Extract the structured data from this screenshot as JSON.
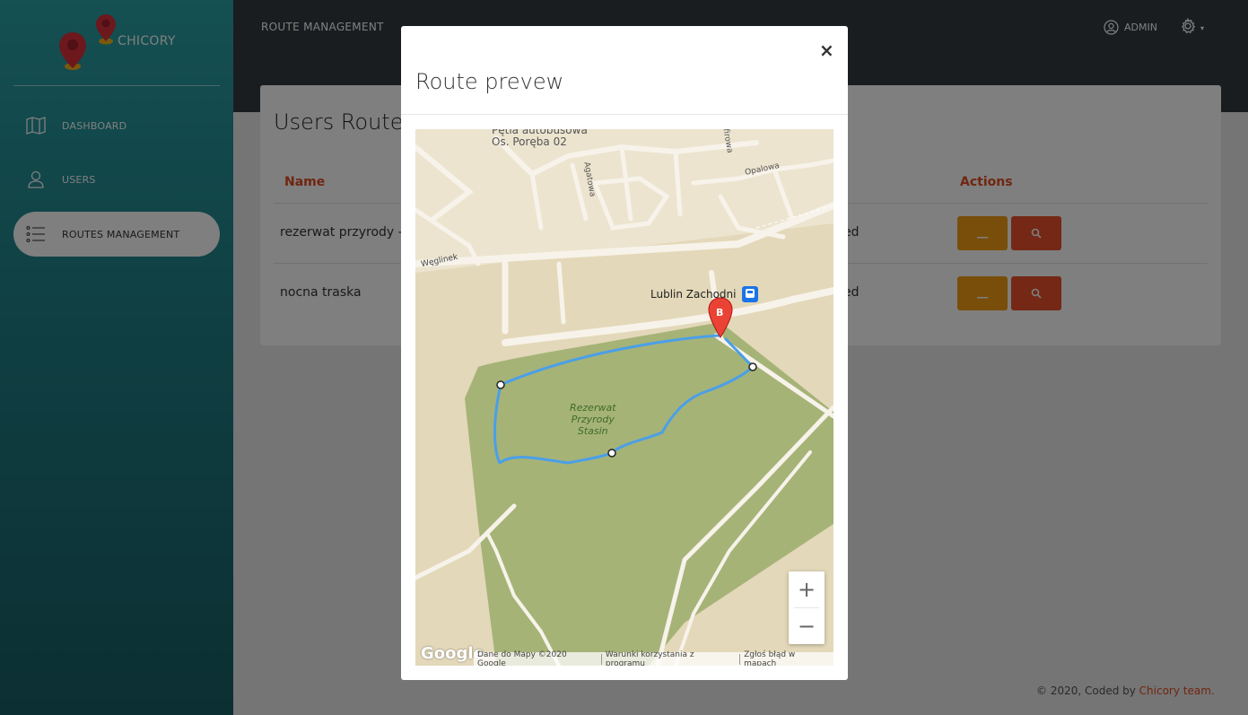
{
  "brand": {
    "name": "CHICORY",
    "pin_colors": [
      "#e0303a",
      "#f3b21b"
    ]
  },
  "topbar": {
    "title": "ROUTE MANAGEMENT",
    "user_label": "ADMIN"
  },
  "sidebar": {
    "items": [
      {
        "label": "DASHBOARD",
        "icon": "map-icon",
        "active": false
      },
      {
        "label": "USERS",
        "icon": "user-icon",
        "active": false
      },
      {
        "label": "ROUTES MANAGEMENT",
        "icon": "list-icon",
        "active": true
      }
    ]
  },
  "card": {
    "title": "Users Route",
    "columns": {
      "name": "Name",
      "actions": "Actions"
    },
    "rows": [
      {
        "name": "rezerwat przyrody -",
        "status": "ed"
      },
      {
        "name": "nocna traska",
        "status": "ed"
      }
    ]
  },
  "modal": {
    "title": "Route prevew",
    "close": "×",
    "map": {
      "labels": {
        "stop": "Pętla autobusowa\nOs. Poręba 02",
        "street_agatowa": "Agatowa",
        "street_opalowa": "Opalowa",
        "street_weglinek": "Węglinek",
        "street_firowa": "firowa",
        "station": "Lublin Zachodni",
        "reserve": "Rezerwat\nPrzyrody\nStasin"
      },
      "marker": "B",
      "zoom_in": "+",
      "zoom_out": "−",
      "logo": "Google",
      "attribution": [
        "Dane do Mapy ©2020 Google",
        "Warunki korzystania z programu",
        "Zgłoś błąd w mapach"
      ]
    }
  },
  "footer": {
    "prefix": "© 2020, Coded by ",
    "team": "Chicory team."
  },
  "colors": {
    "accent": "#e14c21",
    "warning": "#f29c15",
    "danger": "#e8502a",
    "route": "#4a9fe8",
    "park": "#a7b57a"
  }
}
